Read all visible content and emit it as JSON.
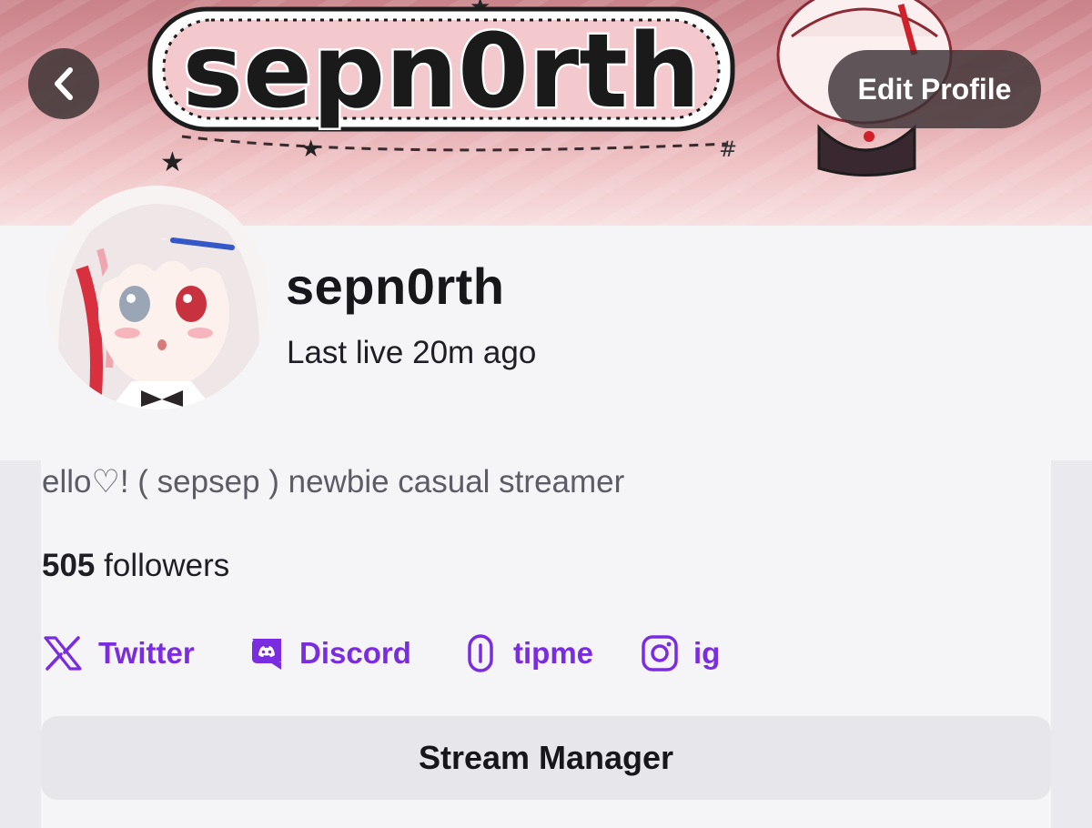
{
  "banner": {
    "logo_text": "sepn0rth",
    "back_label": "Back",
    "edit_profile_label": "Edit Profile"
  },
  "profile": {
    "channel_name": "sepn0rth",
    "last_live": "Last live 20m ago",
    "bio": "ello♡! ( sepsep ) newbie casual streamer",
    "followers_count": "505",
    "followers_label": "followers"
  },
  "social_links": [
    {
      "label": "Twitter",
      "icon": "x-twitter-icon"
    },
    {
      "label": "Discord",
      "icon": "discord-icon"
    },
    {
      "label": "tipme",
      "icon": "link-icon"
    },
    {
      "label": "ig",
      "icon": "instagram-icon"
    }
  ],
  "actions": {
    "stream_manager_label": "Stream Manager"
  },
  "colors": {
    "accent": "#7a2ce0",
    "banner_pink": "#dd9ea4",
    "background": "#f5f5f8"
  }
}
